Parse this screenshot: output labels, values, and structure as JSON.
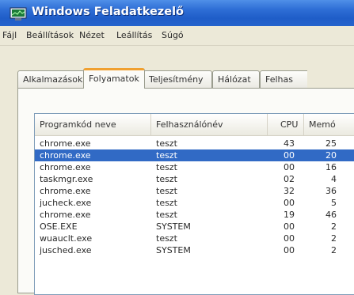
{
  "window": {
    "title": "Windows Feladatkezelő"
  },
  "menu": [
    "Fájl",
    "Beállítások",
    "Nézet",
    "Leállítás",
    "Súgó"
  ],
  "tabs": [
    {
      "label": "Alkalmazások",
      "active": false
    },
    {
      "label": "Folyamatok",
      "active": true
    },
    {
      "label": "Teljesítmény",
      "active": false
    },
    {
      "label": "Hálózat",
      "active": false
    },
    {
      "label": "Felhas",
      "active": false
    }
  ],
  "columns": {
    "image_name": "Programkód neve",
    "user_name": "Felhasználónév",
    "cpu": "CPU",
    "memory": "Memó"
  },
  "processes": [
    {
      "name": "chrome.exe",
      "user": "teszt",
      "cpu": "43",
      "mem": "25",
      "selected": false
    },
    {
      "name": "chrome.exe",
      "user": "teszt",
      "cpu": "00",
      "mem": "20",
      "selected": true
    },
    {
      "name": "chrome.exe",
      "user": "teszt",
      "cpu": "00",
      "mem": "16",
      "selected": false
    },
    {
      "name": "taskmgr.exe",
      "user": "teszt",
      "cpu": "02",
      "mem": "4",
      "selected": false
    },
    {
      "name": "chrome.exe",
      "user": "teszt",
      "cpu": "32",
      "mem": "36",
      "selected": false
    },
    {
      "name": "jucheck.exe",
      "user": "teszt",
      "cpu": "00",
      "mem": "5",
      "selected": false
    },
    {
      "name": "chrome.exe",
      "user": "teszt",
      "cpu": "19",
      "mem": "46",
      "selected": false
    },
    {
      "name": "OSE.EXE",
      "user": "SYSTEM",
      "cpu": "00",
      "mem": "2",
      "selected": false
    },
    {
      "name": "wuauclt.exe",
      "user": "teszt",
      "cpu": "00",
      "mem": "2",
      "selected": false
    },
    {
      "name": "jusched.exe",
      "user": "SYSTEM",
      "cpu": "00",
      "mem": "2",
      "selected": false
    }
  ],
  "colors": {
    "titlebar": "#2463cc",
    "selection": "#316ac5",
    "active_tab_accent": "#f0a030"
  }
}
